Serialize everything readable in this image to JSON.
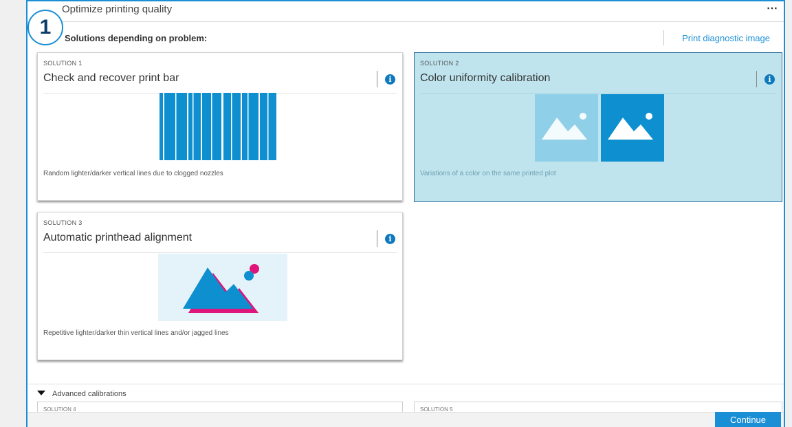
{
  "step_number": "1",
  "header": {
    "title": "Optimize printing quality",
    "more_icon": "more-horizontal-icon"
  },
  "subheader": {
    "title": "Solutions depending on problem:",
    "diagnostic_link": "Print diagnostic image"
  },
  "solutions": [
    {
      "label": "SOLUTION 1",
      "title": "Check and recover print bar",
      "description": "Random lighter/darker vertical lines due to clogged nozzles",
      "icon": "info-icon",
      "selected": false
    },
    {
      "label": "SOLUTION 2",
      "title": "Color uniformity calibration",
      "description": "Variations of a color on the same printed plot",
      "icon": "info-icon",
      "selected": true
    },
    {
      "label": "SOLUTION 3",
      "title": "Automatic printhead alignment",
      "description": "Repetitive lighter/darker thin vertical lines and/or jagged lines",
      "icon": "info-icon",
      "selected": false
    }
  ],
  "advanced": {
    "label": "Advanced calibrations",
    "stub_1_label": "SOLUTION 4",
    "stub_2_label": "SOLUTION 5"
  },
  "footer": {
    "continue_label": "Continue"
  },
  "colors": {
    "accent": "#1a8fd6",
    "selected_card": "#bfe4ee",
    "magenta": "#e0157b",
    "info": "#0f79bd"
  }
}
